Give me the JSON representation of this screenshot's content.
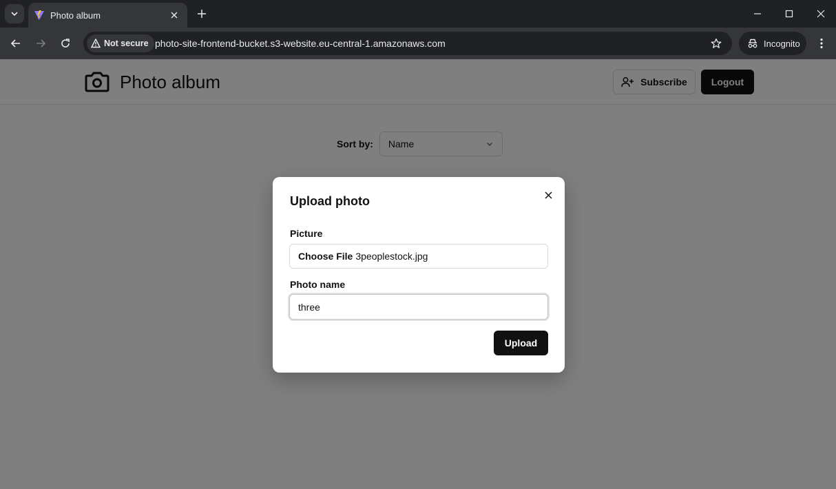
{
  "browser": {
    "tab_title": "Photo album",
    "security_label": "Not secure",
    "url": "photo-site-frontend-bucket.s3-website.eu-central-1.amazonaws.com",
    "incognito_label": "Incognito"
  },
  "header": {
    "title": "Photo album",
    "subscribe_label": "Subscribe",
    "logout_label": "Logout"
  },
  "sort": {
    "label": "Sort by:",
    "selected": "Name"
  },
  "dialog": {
    "title": "Upload photo",
    "picture_label": "Picture",
    "file_button": "Choose File",
    "file_name": "3peoplestock.jpg",
    "photo_name_label": "Photo name",
    "photo_name_value": "three",
    "upload_label": "Upload"
  },
  "colors": {
    "primary_button": "#111111",
    "overlay": "rgba(0,0,0,0.5)"
  }
}
